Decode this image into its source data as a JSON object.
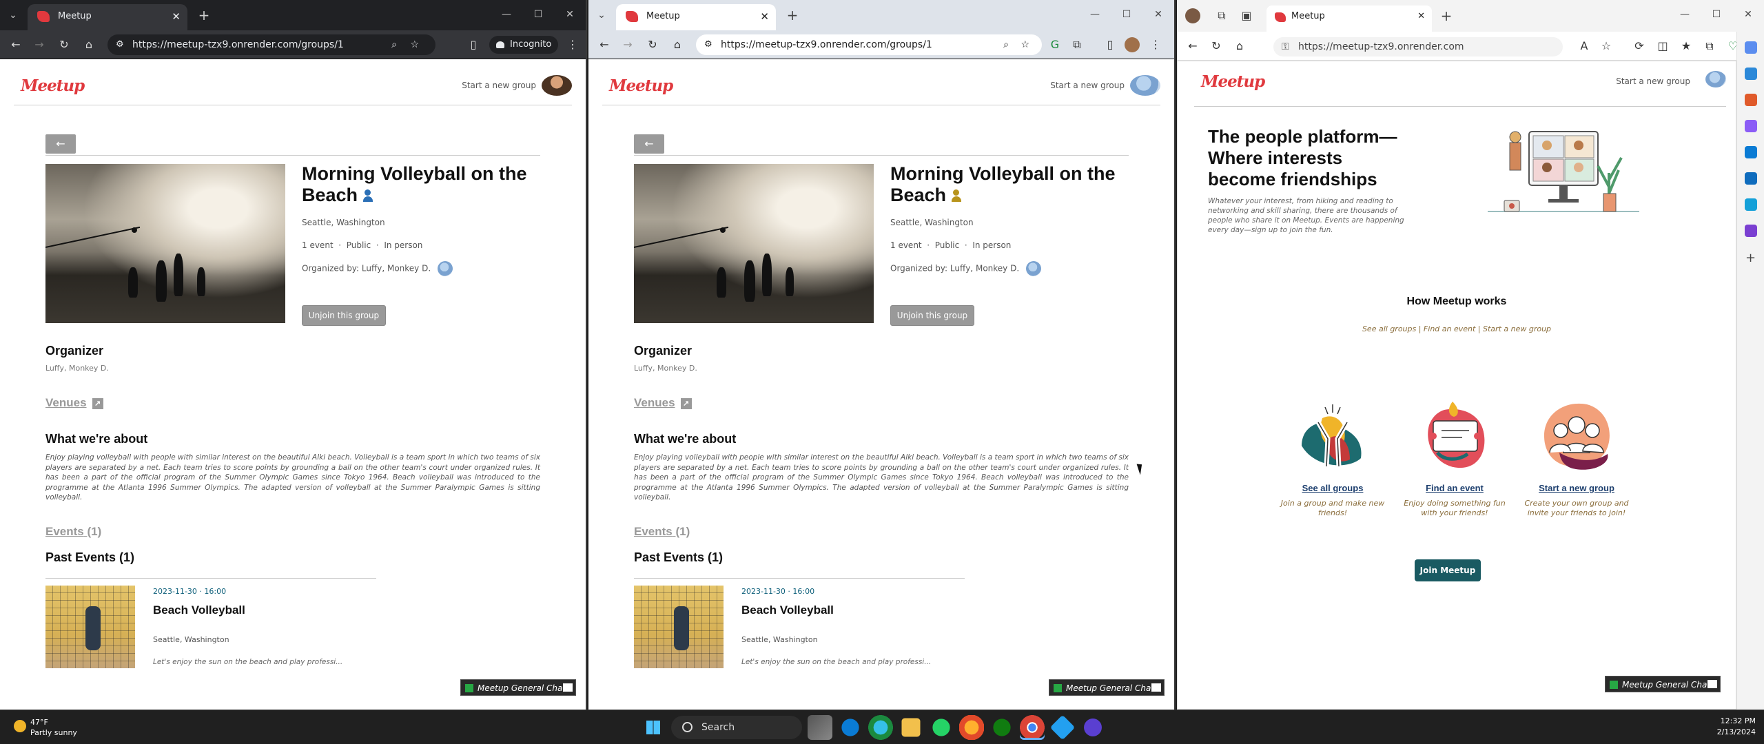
{
  "windows": [
    {
      "tab_title": "Meetup",
      "url": "https://meetup-tzx9.onrender.com/groups/1",
      "incognito_label": "Incognito"
    },
    {
      "tab_title": "Meetup",
      "url": "https://meetup-tzx9.onrender.com/groups/1"
    },
    {
      "tab_title": "Meetup",
      "url": "https://meetup-tzx9.onrender.com"
    }
  ],
  "site": {
    "logo": "Meetup",
    "start_group": "Start a new group",
    "chat_label": "Meetup General Chat"
  },
  "group": {
    "title": "Morning Volleyball on the Beach",
    "location": "Seattle, Washington",
    "meta_events": "1 event",
    "meta_public": "Public",
    "meta_type": "In person",
    "organized_by": "Organized by: Luffy, Monkey D.",
    "unjoin": "Unjoin this group",
    "organizer_heading": "Organizer",
    "organizer_name": "Luffy, Monkey D.",
    "venues_link": "Venues",
    "about_heading": "What we're about",
    "about_text": "Enjoy playing volleyball with people with similar interest on the beautiful Alki beach. Volleyball is a team sport in which two teams of six players are separated by a net. Each team tries to score points by grounding a ball on the other team's court under organized rules. It has been a part of the official program of the Summer Olympic Games since Tokyo 1964. Beach volleyball was introduced to the programme at the Atlanta 1996 Summer Olympics. The adapted version of volleyball at the Summer Paralympic Games is sitting volleyball.",
    "events_link": "Events",
    "events_count": "(1)",
    "past_events_heading": "Past Events (1)",
    "event": {
      "date": "2023-11-30 · 16:00",
      "title": "Beach Volleyball",
      "location": "Seattle, Washington",
      "description": "Let's enjoy the sun on the beach and play professi..."
    }
  },
  "home": {
    "hero_title": "The people platform—Where interests become friendships",
    "hero_sub": "Whatever your interest, from hiking and reading to networking and skill sharing, there are thousands of people who share it on Meetup. Events are happening every day—sign up to join the fun.",
    "how_heading": "How Meetup works",
    "how_links": "See all groups | Find an event | Start a new group",
    "cards": [
      {
        "title": "See all groups",
        "desc": "Join a group and make new friends!"
      },
      {
        "title": "Find an event",
        "desc": "Enjoy doing something fun with your friends!"
      },
      {
        "title": "Start a new group",
        "desc": "Create your own group and invite your friends to join!"
      }
    ],
    "join_button": "Join Meetup"
  },
  "taskbar": {
    "temp": "47°F",
    "weather": "Partly sunny",
    "search": "Search",
    "time": "12:32 PM",
    "date": "2/13/2024"
  },
  "colors": {
    "brand": "#e0393e",
    "join_button": "#1a5a62",
    "link_brown": "#8a6d3b"
  }
}
